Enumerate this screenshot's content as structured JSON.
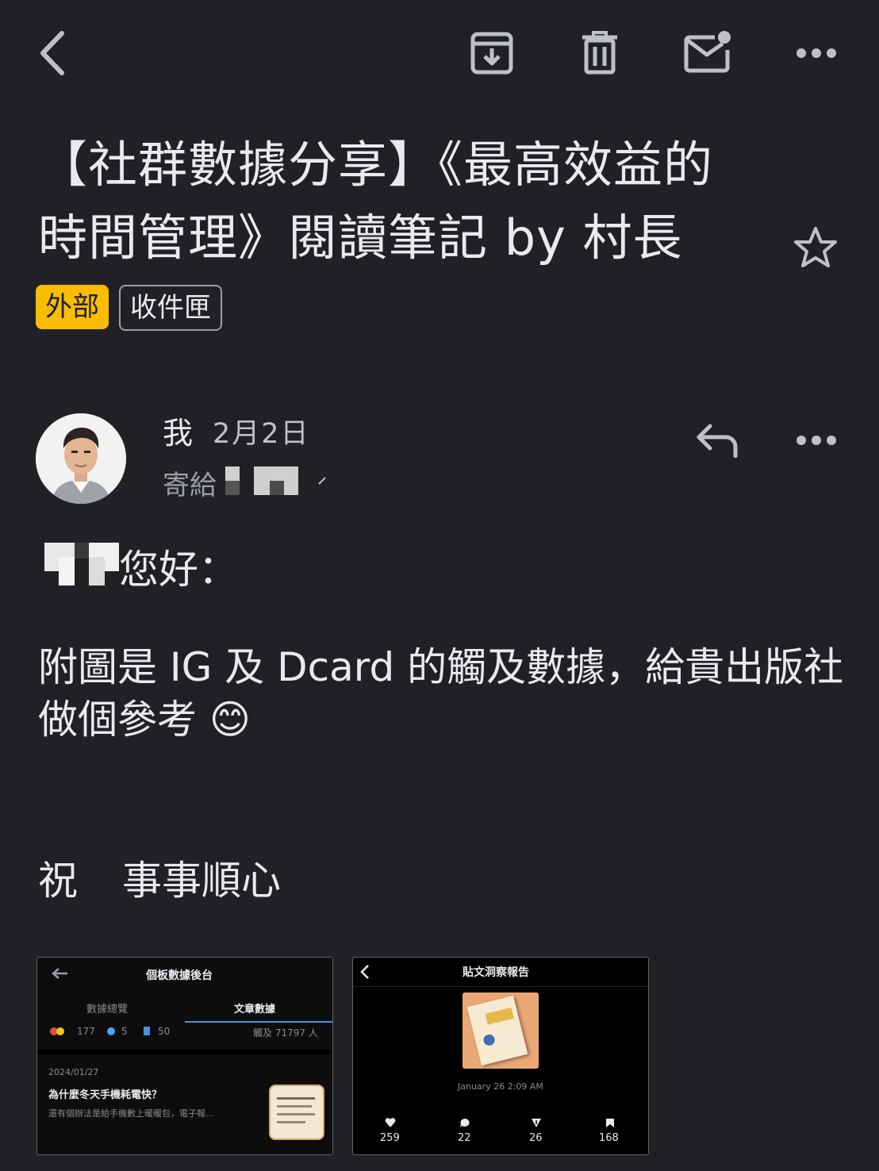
{
  "toolbar": {
    "back": "back-arrow-icon",
    "archive": "archive-icon",
    "delete": "trash-icon",
    "mark_unread": "mark-unread-icon",
    "more": "more-dots-icon"
  },
  "email": {
    "subject": "【社群數據分享】《最高效益的時間管理》閱讀筆記 by 村長",
    "labels": [
      "外部",
      "收件匣"
    ],
    "sender": "我",
    "date": "2月2日",
    "to_label": "寄給",
    "greeting_suffix": "您好：",
    "body_line": "附圖是 IG 及 Dcard 的觸及數據，給貴出版社做個參考",
    "emoji": "😊",
    "closing_1": "祝",
    "closing_2": "事事順心"
  },
  "attachment1": {
    "title": "個板數據後台",
    "tab_overview": "數據總覽",
    "tab_posts": "文章數據",
    "likes": "177",
    "comments": "5",
    "saves": "50",
    "reach": "觸及 71797 人",
    "post_date": "2024/01/27",
    "post_title": "為什麼冬天手機耗電快？",
    "post_excerpt": "還有個辦法是給手機數上暖暖包，電子報..."
  },
  "attachment2": {
    "title": "貼文洞察報告",
    "timestamp": "January 26 2:09 AM",
    "stats": [
      "259",
      "22",
      "26",
      "168"
    ]
  },
  "colors": {
    "background": "#202124",
    "text": "#e8eaed",
    "external_chip": "#fbbc04",
    "muted": "#9aa0a6"
  }
}
